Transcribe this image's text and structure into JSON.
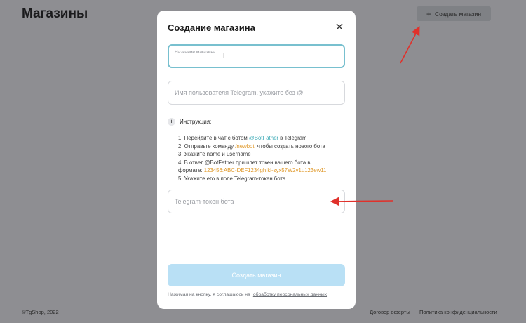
{
  "page": {
    "title": "Магазины",
    "create_button_label": "Создать магазин",
    "create_button_icon": "plus-icon"
  },
  "footer": {
    "copyright": "©TgShop, 2022",
    "offer_link": "Договор оферты",
    "privacy_link": "Политика конфиденциальности"
  },
  "modal": {
    "title": "Создание магазина",
    "close_icon": "close-icon",
    "shop_name_label": "Название магазина",
    "username_placeholder": "Имя пользователя Telegram, укажите без @",
    "instruction_title": "Инструкция:",
    "steps": {
      "s1_a": "1. Перейдите в чат с ботом ",
      "s1_link": "@BotFather",
      "s1_b": " в Telegram",
      "s2_a": "2. Отправьте команду ",
      "s2_cmd": "/newbot",
      "s2_b": ", чтобы создать нового бота",
      "s3": "3. Укажите name и username",
      "s4_a": "4. В ответ @BotFather пришлет токен вашего бота в",
      "s4_b": "формате: ",
      "s4_token": "123456:ABC-DEF1234ghIkl-zyx57W2v1u123ew11",
      "s5": "5. Укажите его в поле Telegram-токен бота"
    },
    "token_placeholder": "Telegram-токен бота",
    "submit_label": "Создать магазин",
    "consent_text": "Нажимая на кнопку, я соглашаюсь на",
    "consent_link": "обработку персональных данных"
  },
  "colors": {
    "overlay": "#8e8e92",
    "accent_teal": "#3aa9b5",
    "accent_orange": "#e09a2c",
    "submit_disabled": "#b9e0f5",
    "annotation_arrow": "#e0312b"
  }
}
